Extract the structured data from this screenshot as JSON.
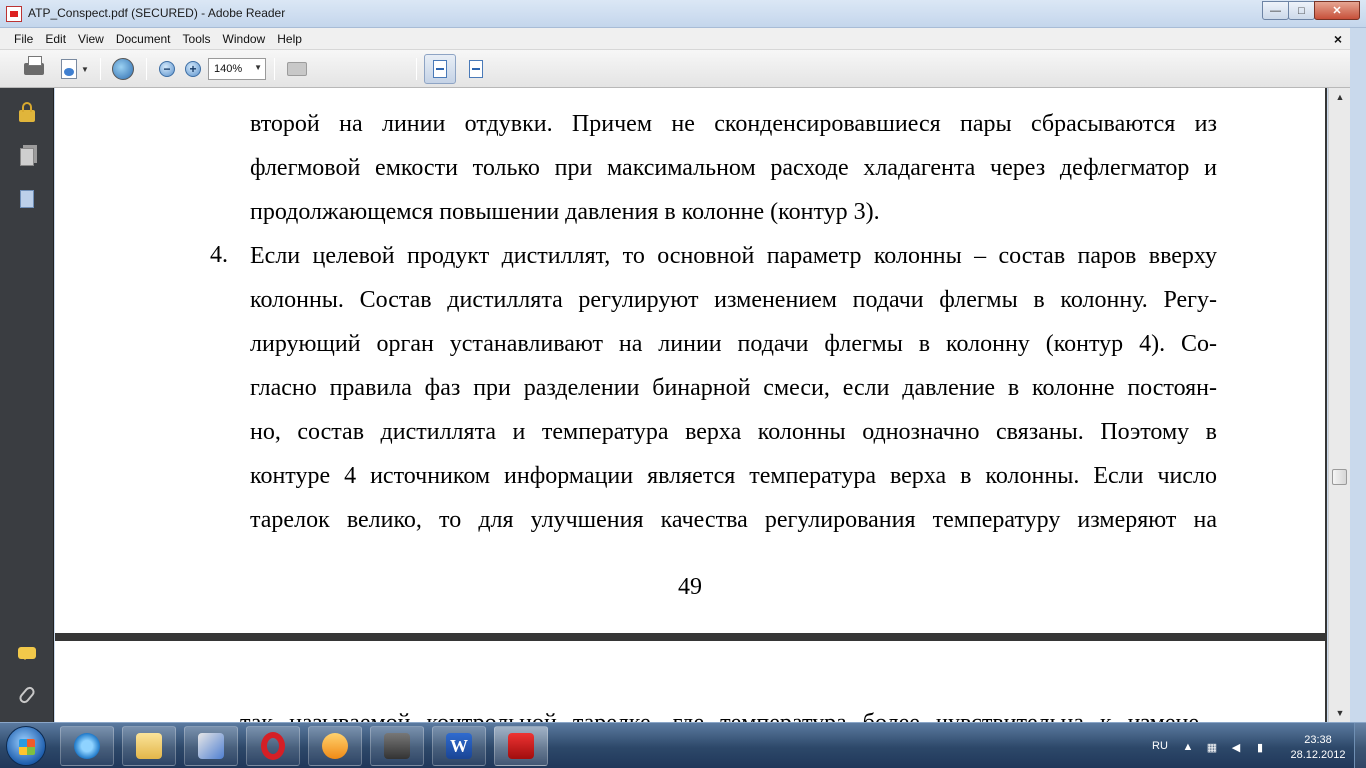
{
  "window": {
    "title": "ATP_Conspect.pdf (SECURED) - Adobe Reader",
    "minimize": "—",
    "maximize": "□",
    "close": "✕"
  },
  "menu": {
    "items": [
      "File",
      "Edit",
      "View",
      "Document",
      "Tools",
      "Window",
      "Help"
    ],
    "close_doc": "×"
  },
  "toolbar": {
    "zoom_value": "140%",
    "zoom_out": "−",
    "zoom_in": "+"
  },
  "document": {
    "page1_lines": [
      "второй на линии отдувки. Причем не сконденсировавшиеся пары сбрасываются из",
      "флегмовой емкости только при максимальном расходе хладагента через дефлегматор и",
      "продолжающемся повышении давления в колонне (контур 3).",
      "Если целевой продукт дистиллят, то основной параметр колонны – состав паров вверху",
      "колонны. Состав дистиллята регулируют изменением подачи флегмы в колонну. Регу-",
      "лирующий орган устанавливают на линии подачи флегмы в колонну (контур 4). Со-",
      "гласно правила фаз при разделении бинарной смеси, если давление в колонне постоян-",
      "но, состав дистиллята и температура верха колонны однозначно связаны. Поэтому в",
      "контуре 4 источником информации является температура верха в колонны. Если число",
      "тарелок велико, то для улучшения качества регулирования температуру измеряют на"
    ],
    "list_number": "4.",
    "page_number": "49",
    "page2_partial_line": "так называемой контрольной тарелке, где температура более чувствительна к измене-"
  },
  "taskbar": {
    "language": "RU",
    "time": "23:38",
    "date": "28.12.2012",
    "word_label": "W"
  }
}
